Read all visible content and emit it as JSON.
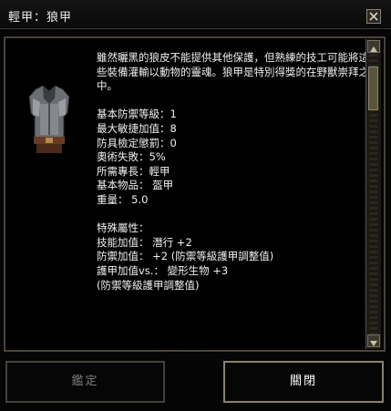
{
  "window": {
    "title": "輕甲：狼甲"
  },
  "item": {
    "icon": "leather-armor-icon",
    "description": "雖然曬黑的狼皮不能提供其他保護，但熟練的技工可能將這些裝備灌輸以動物的靈魂。狼甲是特別得獎的在野獸崇拜之中。",
    "stats": [
      "基本防禦等級：1",
      "最大敏捷加值：8",
      "防具檢定懲罰：0",
      "奧術失敗：5%",
      "所需專長：輕甲",
      "基本物品： 盔甲",
      "重量： 5.0"
    ],
    "special_header": "特殊屬性：",
    "special": [
      "技能加值： 潛行 +2",
      "防禦加值： +2 (防禦等級護甲調整值)",
      "護甲加值vs.： 變形生物 +3",
      "(防禦等級護甲調整值)"
    ]
  },
  "buttons": {
    "identify_label": "鑑定",
    "close_label": "關閉"
  },
  "colors": {
    "border": "#4a4538",
    "text": "#f0f0f0",
    "disabled_text": "#7c7c7c"
  }
}
